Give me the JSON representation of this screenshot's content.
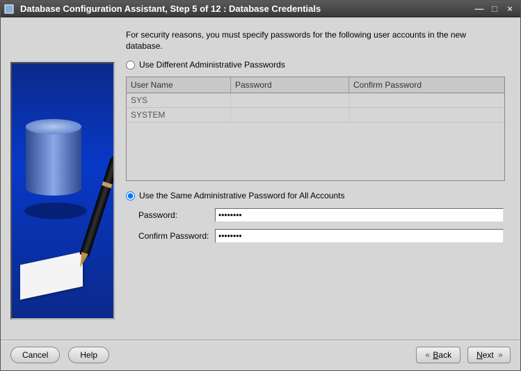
{
  "titlebar": {
    "title": "Database Configuration Assistant, Step 5 of 12 : Database Credentials"
  },
  "intro": "For security reasons, you must specify passwords for the following user accounts in the new database.",
  "option_different": {
    "label": "Use Different Administrative Passwords",
    "selected": false
  },
  "cred_table": {
    "headers": {
      "user": "User Name",
      "pwd": "Password",
      "confirm": "Confirm Password"
    },
    "rows": [
      "SYS",
      "SYSTEM"
    ]
  },
  "option_same": {
    "label": "Use the Same Administrative Password for All Accounts",
    "selected": true
  },
  "fields": {
    "password_label": "Password:",
    "password_value": "********",
    "confirm_label": "Confirm Password:",
    "confirm_value": "********"
  },
  "buttons": {
    "cancel": "Cancel",
    "help": "Help",
    "back": "Back",
    "next": "Next"
  }
}
